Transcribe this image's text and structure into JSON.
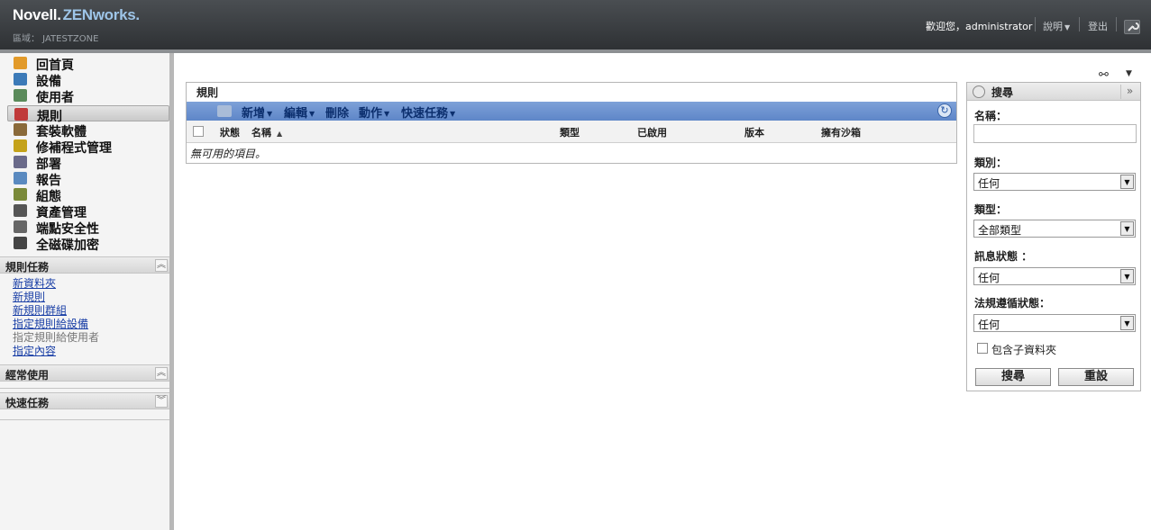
{
  "header": {
    "brand_novell": "Novell.",
    "brand_product": "ZENworks.",
    "zone": "區域： JATESTZONE",
    "welcome": "歡迎您，administrator",
    "help": "說明",
    "logout": "登出"
  },
  "sidebar": {
    "nav": [
      {
        "label": "回首頁",
        "icon": "home-icon",
        "color": "#e29a2a"
      },
      {
        "label": "設備",
        "icon": "monitor-icon",
        "color": "#3c7ab8"
      },
      {
        "label": "使用者",
        "icon": "users-icon",
        "color": "#5a8a5a"
      },
      {
        "label": "規則",
        "icon": "policy-icon",
        "color": "#c03a3a"
      },
      {
        "label": "套裝軟體",
        "icon": "bundle-icon",
        "color": "#8a6a3a"
      },
      {
        "label": "修補程式管理",
        "icon": "shield-icon",
        "color": "#c4a21a"
      },
      {
        "label": "部署",
        "icon": "deploy-icon",
        "color": "#6a6a8a"
      },
      {
        "label": "報告",
        "icon": "report-icon",
        "color": "#5a8ac0"
      },
      {
        "label": "組態",
        "icon": "wrench-icon",
        "color": "#7a8a3a"
      },
      {
        "label": "資產管理",
        "icon": "asset-icon",
        "color": "#555555"
      },
      {
        "label": "端點安全性",
        "icon": "lock-icon",
        "color": "#666666"
      },
      {
        "label": "全磁碟加密",
        "icon": "disk-icon",
        "color": "#444444"
      }
    ],
    "tasks_title": "規則任務",
    "tasks": [
      {
        "label": "新資料夾",
        "enabled": true
      },
      {
        "label": "新規則",
        "enabled": true
      },
      {
        "label": "新規則群組",
        "enabled": true
      },
      {
        "label": "指定規則給設備",
        "enabled": true
      },
      {
        "label": "指定規則給使用者",
        "enabled": false
      },
      {
        "label": "指定內容",
        "enabled": true
      }
    ],
    "frequent_title": "經常使用",
    "quick_title": "快速任務"
  },
  "rules": {
    "title": "規則",
    "toolbar": {
      "new": "新增",
      "edit": "編輯",
      "delete": "刪除",
      "action": "動作",
      "quick": "快速任務"
    },
    "columns": {
      "status": "狀態",
      "name": "名稱",
      "type": "類型",
      "enabled": "已啟用",
      "version": "版本",
      "sandbox": "擁有沙箱"
    },
    "empty": "無可用的項目。"
  },
  "search": {
    "title": "搜尋",
    "name_label": "名稱：",
    "name_value": "",
    "category_label": "類別：",
    "category_value": "任何",
    "type_label": "類型：",
    "type_value": "全部類型",
    "message_label": "訊息狀態 ：",
    "message_value": "任何",
    "compliance_label": "法規遵循狀態：",
    "compliance_value": "任何",
    "include_subfolders": "包含子資料夾",
    "search_btn": "搜尋",
    "reset_btn": "重設"
  }
}
